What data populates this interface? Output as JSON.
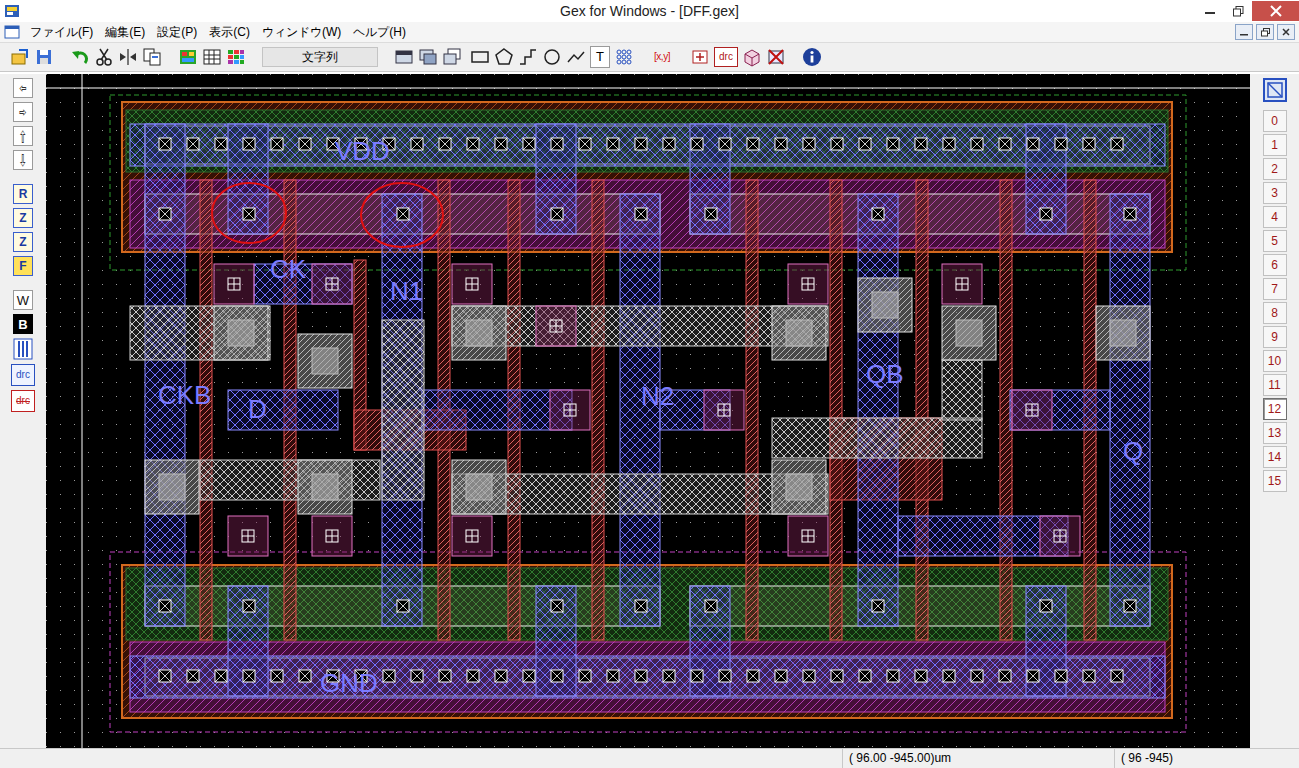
{
  "window": {
    "title": "Gex for Windows - [DFF.gex]"
  },
  "menu": [
    "ファイル(F)",
    "編集(E)",
    "設定(P)",
    "表示(C)",
    "ウィンドウ(W)",
    "ヘルプ(H)"
  ],
  "toolbar": {
    "text_field": "文字列",
    "text_tool": "T",
    "coord_tool": "[x,y]",
    "drc_tool": "drc"
  },
  "left_toolbar": [
    {
      "label": "⇦",
      "kind": "arrow"
    },
    {
      "label": "⇨",
      "kind": "arrow"
    },
    {
      "label": "⇧",
      "kind": "arrow"
    },
    {
      "label": "⇩",
      "kind": "arrow"
    },
    {
      "label": "R",
      "kind": "mode"
    },
    {
      "label": "Z",
      "kind": "mode"
    },
    {
      "label": "Z",
      "kind": "mode"
    },
    {
      "label": "F",
      "kind": "fill"
    },
    {
      "label": "W",
      "kind": "plain"
    },
    {
      "label": "B",
      "kind": "inverse"
    },
    {
      "label": "drc",
      "kind": "drc"
    },
    {
      "label": "drc",
      "kind": "drc-off"
    }
  ],
  "canvas": {
    "labels": [
      {
        "text": "VDD"
      },
      {
        "text": "GND"
      },
      {
        "text": "CK"
      },
      {
        "text": "N1"
      },
      {
        "text": "CKB"
      },
      {
        "text": "D"
      },
      {
        "text": "N2"
      },
      {
        "text": "QB"
      },
      {
        "text": "Q"
      }
    ]
  },
  "layers": [
    {
      "label": "0",
      "selected": false
    },
    {
      "label": "1",
      "selected": false
    },
    {
      "label": "2",
      "selected": false
    },
    {
      "label": "3",
      "selected": false
    },
    {
      "label": "4",
      "selected": false
    },
    {
      "label": "5",
      "selected": false
    },
    {
      "label": "6",
      "selected": false
    },
    {
      "label": "7",
      "selected": false
    },
    {
      "label": "8",
      "selected": false
    },
    {
      "label": "9",
      "selected": false
    },
    {
      "label": "10",
      "selected": false
    },
    {
      "label": "11",
      "selected": false
    },
    {
      "label": "12",
      "selected": true
    },
    {
      "label": "13",
      "selected": false
    },
    {
      "label": "14",
      "selected": false
    },
    {
      "label": "15",
      "selected": false
    }
  ],
  "status_bar": {
    "coord_um": "( 96.00 -945.00)um",
    "coord_grid": "( 96 -945)"
  }
}
